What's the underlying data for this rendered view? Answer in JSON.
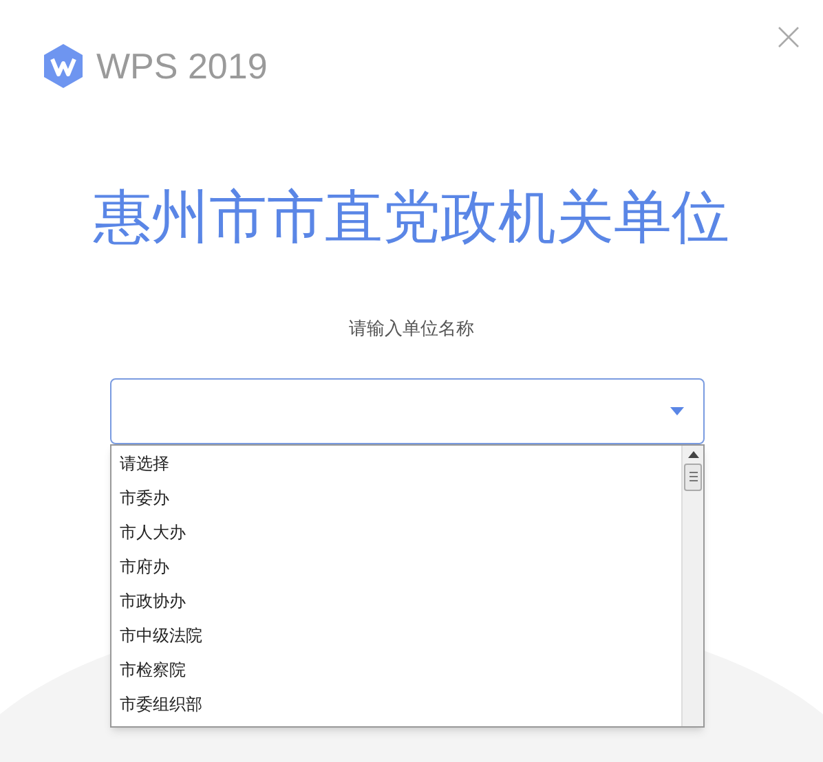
{
  "window": {
    "brand": "WPS 2019"
  },
  "title": "惠州市市直党政机关单位",
  "prompt": "请输入单位名称",
  "select": {
    "expanded": true
  },
  "options": [
    {
      "label": "请选择",
      "selected": false
    },
    {
      "label": "市委办",
      "selected": false
    },
    {
      "label": "市人大办",
      "selected": false
    },
    {
      "label": "市府办",
      "selected": false
    },
    {
      "label": "市政协办",
      "selected": false
    },
    {
      "label": "市中级法院",
      "selected": false
    },
    {
      "label": "市检察院",
      "selected": false
    },
    {
      "label": "市委组织部",
      "selected": false
    }
  ]
}
